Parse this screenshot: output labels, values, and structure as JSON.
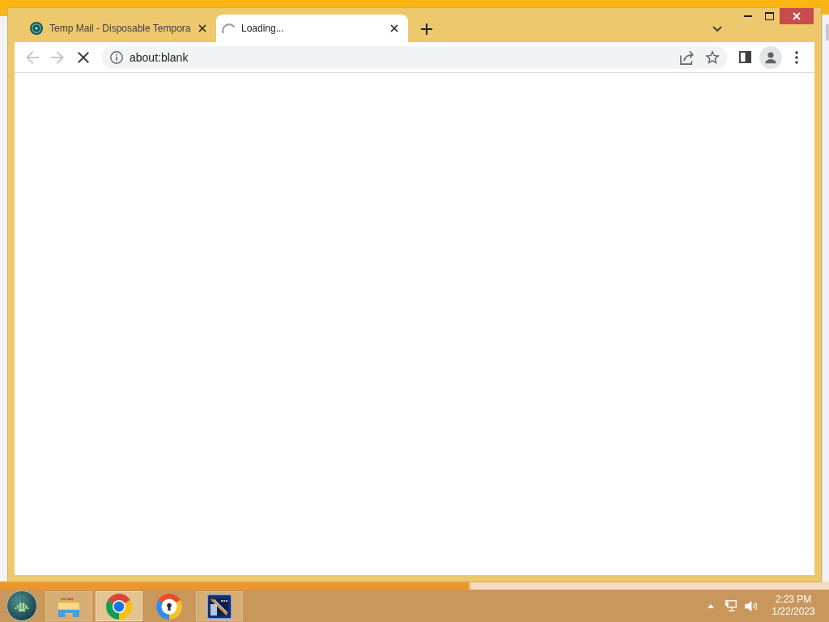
{
  "browser": {
    "tabs": [
      {
        "kind": "page",
        "title": "Temp Mail - Disposable Tempora",
        "selected": false
      },
      {
        "kind": "loading",
        "title": "Loading...",
        "selected": true
      }
    ],
    "toolbar": {
      "back": {
        "disabled": true
      },
      "forward": {
        "disabled": true
      },
      "reload": {
        "kind": "stop"
      },
      "address": "about:blank"
    }
  },
  "taskbar": {
    "apps": [
      {
        "kind": "files",
        "running": true,
        "selected": false
      },
      {
        "kind": "browser",
        "running": true,
        "selected": true
      },
      {
        "kind": "secure-browser",
        "running": false,
        "selected": false
      },
      {
        "kind": "editor",
        "running": true,
        "selected": false
      }
    ],
    "clock": {
      "time": "2:23 PM",
      "date": "1/22/2023"
    }
  }
}
